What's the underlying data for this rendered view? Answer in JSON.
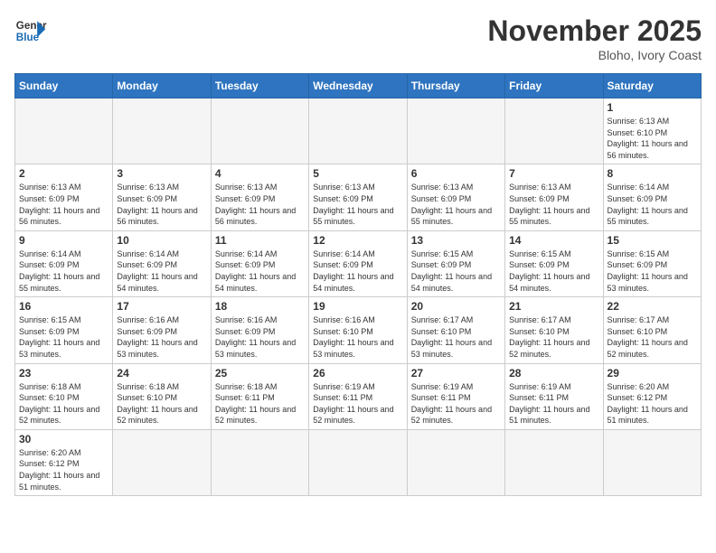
{
  "header": {
    "logo_general": "General",
    "logo_blue": "Blue",
    "month_title": "November 2025",
    "location": "Bloho, Ivory Coast"
  },
  "weekdays": [
    "Sunday",
    "Monday",
    "Tuesday",
    "Wednesday",
    "Thursday",
    "Friday",
    "Saturday"
  ],
  "days": {
    "1": {
      "sunrise": "6:13 AM",
      "sunset": "6:10 PM",
      "daylight": "11 hours and 56 minutes."
    },
    "2": {
      "sunrise": "6:13 AM",
      "sunset": "6:09 PM",
      "daylight": "11 hours and 56 minutes."
    },
    "3": {
      "sunrise": "6:13 AM",
      "sunset": "6:09 PM",
      "daylight": "11 hours and 56 minutes."
    },
    "4": {
      "sunrise": "6:13 AM",
      "sunset": "6:09 PM",
      "daylight": "11 hours and 56 minutes."
    },
    "5": {
      "sunrise": "6:13 AM",
      "sunset": "6:09 PM",
      "daylight": "11 hours and 55 minutes."
    },
    "6": {
      "sunrise": "6:13 AM",
      "sunset": "6:09 PM",
      "daylight": "11 hours and 55 minutes."
    },
    "7": {
      "sunrise": "6:13 AM",
      "sunset": "6:09 PM",
      "daylight": "11 hours and 55 minutes."
    },
    "8": {
      "sunrise": "6:14 AM",
      "sunset": "6:09 PM",
      "daylight": "11 hours and 55 minutes."
    },
    "9": {
      "sunrise": "6:14 AM",
      "sunset": "6:09 PM",
      "daylight": "11 hours and 55 minutes."
    },
    "10": {
      "sunrise": "6:14 AM",
      "sunset": "6:09 PM",
      "daylight": "11 hours and 54 minutes."
    },
    "11": {
      "sunrise": "6:14 AM",
      "sunset": "6:09 PM",
      "daylight": "11 hours and 54 minutes."
    },
    "12": {
      "sunrise": "6:14 AM",
      "sunset": "6:09 PM",
      "daylight": "11 hours and 54 minutes."
    },
    "13": {
      "sunrise": "6:15 AM",
      "sunset": "6:09 PM",
      "daylight": "11 hours and 54 minutes."
    },
    "14": {
      "sunrise": "6:15 AM",
      "sunset": "6:09 PM",
      "daylight": "11 hours and 54 minutes."
    },
    "15": {
      "sunrise": "6:15 AM",
      "sunset": "6:09 PM",
      "daylight": "11 hours and 53 minutes."
    },
    "16": {
      "sunrise": "6:15 AM",
      "sunset": "6:09 PM",
      "daylight": "11 hours and 53 minutes."
    },
    "17": {
      "sunrise": "6:16 AM",
      "sunset": "6:09 PM",
      "daylight": "11 hours and 53 minutes."
    },
    "18": {
      "sunrise": "6:16 AM",
      "sunset": "6:09 PM",
      "daylight": "11 hours and 53 minutes."
    },
    "19": {
      "sunrise": "6:16 AM",
      "sunset": "6:10 PM",
      "daylight": "11 hours and 53 minutes."
    },
    "20": {
      "sunrise": "6:17 AM",
      "sunset": "6:10 PM",
      "daylight": "11 hours and 53 minutes."
    },
    "21": {
      "sunrise": "6:17 AM",
      "sunset": "6:10 PM",
      "daylight": "11 hours and 52 minutes."
    },
    "22": {
      "sunrise": "6:17 AM",
      "sunset": "6:10 PM",
      "daylight": "11 hours and 52 minutes."
    },
    "23": {
      "sunrise": "6:18 AM",
      "sunset": "6:10 PM",
      "daylight": "11 hours and 52 minutes."
    },
    "24": {
      "sunrise": "6:18 AM",
      "sunset": "6:10 PM",
      "daylight": "11 hours and 52 minutes."
    },
    "25": {
      "sunrise": "6:18 AM",
      "sunset": "6:11 PM",
      "daylight": "11 hours and 52 minutes."
    },
    "26": {
      "sunrise": "6:19 AM",
      "sunset": "6:11 PM",
      "daylight": "11 hours and 52 minutes."
    },
    "27": {
      "sunrise": "6:19 AM",
      "sunset": "6:11 PM",
      "daylight": "11 hours and 52 minutes."
    },
    "28": {
      "sunrise": "6:19 AM",
      "sunset": "6:11 PM",
      "daylight": "11 hours and 51 minutes."
    },
    "29": {
      "sunrise": "6:20 AM",
      "sunset": "6:12 PM",
      "daylight": "11 hours and 51 minutes."
    },
    "30": {
      "sunrise": "6:20 AM",
      "sunset": "6:12 PM",
      "daylight": "11 hours and 51 minutes."
    }
  }
}
